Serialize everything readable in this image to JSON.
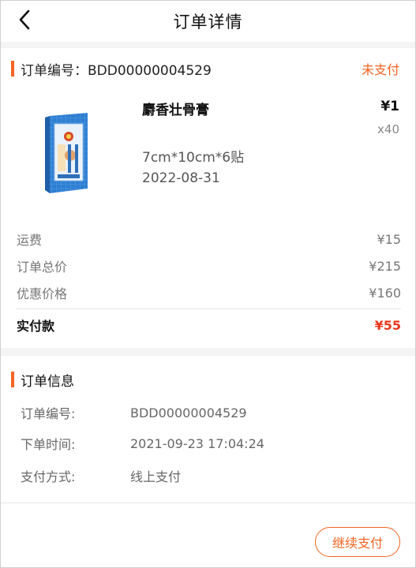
{
  "header": {
    "title": "订单详情",
    "back_icon": "chevron-left-icon"
  },
  "order": {
    "number_label": "订单编号：BDD00000004529",
    "status": "未支付"
  },
  "product": {
    "name": "麝香壮骨膏",
    "price": "¥1",
    "quantity": "x40",
    "spec": "7cm*10cm*6贴",
    "date": "2022-08-31",
    "image_icon": "product-box-image"
  },
  "costs": [
    {
      "label": "运费",
      "value": "¥15"
    },
    {
      "label": "订单总价",
      "value": "¥215"
    },
    {
      "label": "优惠价格",
      "value": "¥160"
    }
  ],
  "paid": {
    "label": "实付款",
    "value": "¥55"
  },
  "info": {
    "title": "订单信息",
    "rows": [
      {
        "label": "订单编号:",
        "value": "BDD00000004529"
      },
      {
        "label": "下单时间:",
        "value": "2021-09-23 17:04:24"
      },
      {
        "label": "支付方式:",
        "value": "线上支付"
      }
    ]
  },
  "actions": {
    "continue_pay": "继续支付"
  },
  "colors": {
    "accent": "#f26522",
    "paid": "#e8381c"
  }
}
